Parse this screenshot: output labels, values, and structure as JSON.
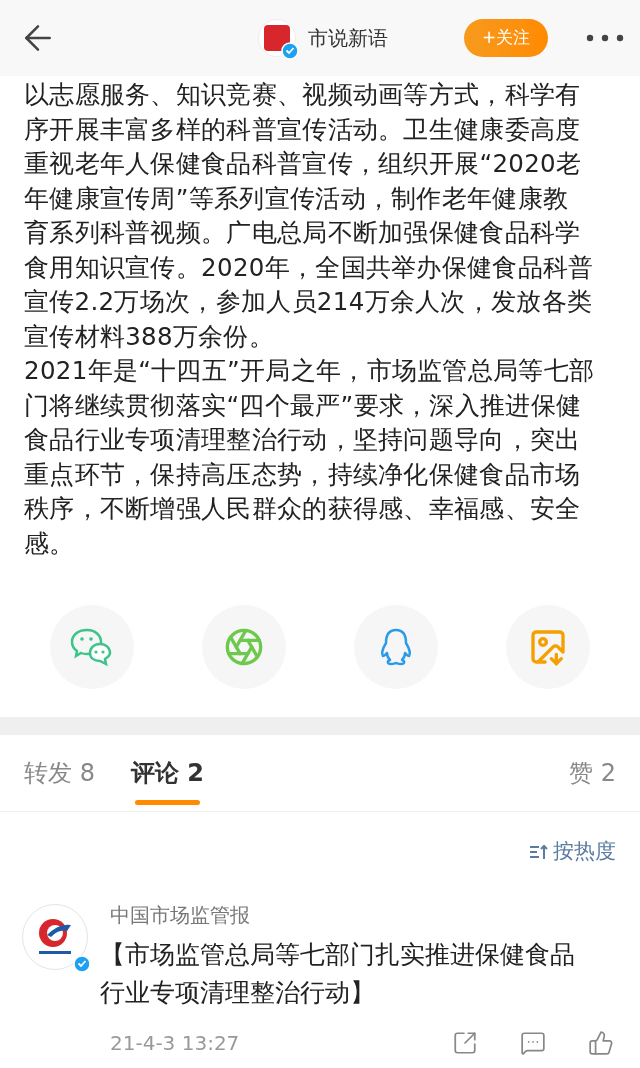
{
  "header": {
    "account_name": "市说新语",
    "follow_button": "+关注"
  },
  "article": {
    "paragraphs": [
      {
        "lines": [
          "以志愿服务、知识竞赛、视频动画等方式，科学有",
          "序开展丰富多样的科普宣传活动。卫生健康委高度",
          "重视老年人保健食品科普宣传，组织开展“2020老",
          "年健康宣传周”等系列宣传活动，制作老年健康教",
          "育系列科普视频。广电总局不断加强保健食品科学",
          "食用知识宣传。2020年，全国共举办保健食品科普",
          "宣传2.2万场次，参加人员214万余人次，发放各类",
          "宣传材料388万余份。"
        ]
      },
      {
        "lines": [
          "2021年是“十四五”开局之年，市场监管总局等七部",
          "门将继续贯彻落实“四个最严”要求，深入推进保健",
          "食品行业专项清理整治行动，坚持问题导向，突出",
          "重点环节，保持高压态势，持续净化保健食品市场",
          "秩序，不断增强人民群众的获得感、幸福感、安全",
          "感。"
        ]
      }
    ]
  },
  "share_buttons": [
    {
      "kind": "wechat"
    },
    {
      "kind": "moments"
    },
    {
      "kind": "qq"
    },
    {
      "kind": "save_image"
    }
  ],
  "tabs": [
    {
      "label": "转发 8",
      "selected": false
    },
    {
      "label": "评论 2",
      "selected": true
    },
    {
      "label": "赞 2",
      "selected": false
    }
  ],
  "sort_button": "按热度",
  "comments": [
    {
      "author": "中国市场监管报",
      "verified": true,
      "lines": [
        "【市场监管总局等七部门扎实推进保健食品",
        "行业专项清理整治行动】"
      ],
      "time": "21-4-3 13:27"
    }
  ]
}
